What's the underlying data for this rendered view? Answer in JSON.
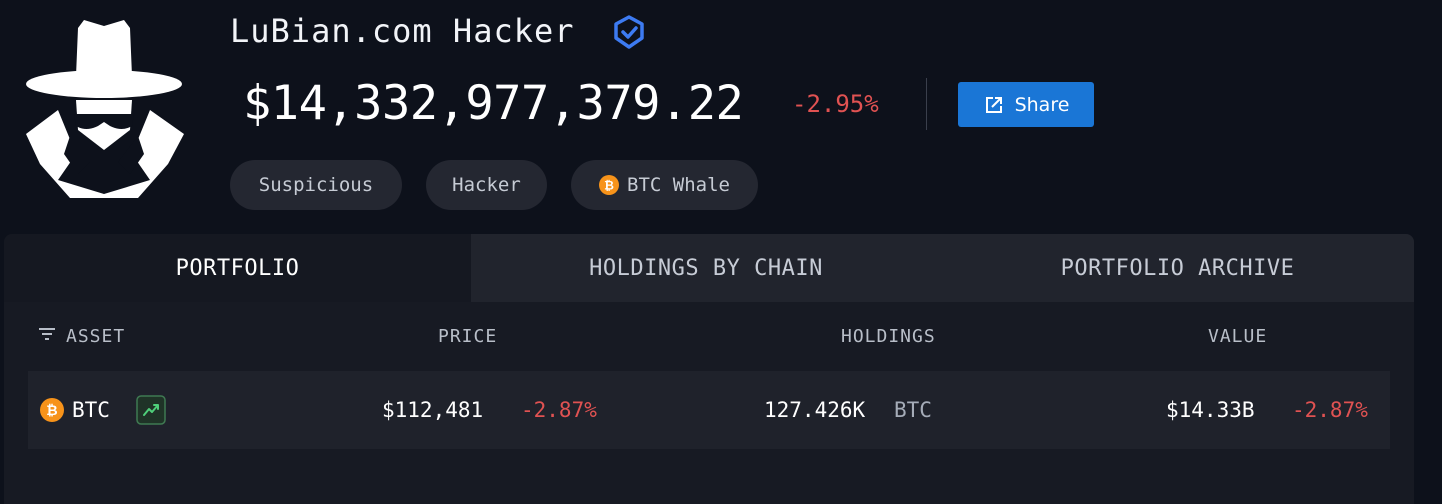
{
  "entity": {
    "name": "LuBian.com Hacker",
    "balance": "$14,332,977,379.22",
    "change": "-2.95%",
    "share_label": "Share"
  },
  "tags": [
    "Suspicious",
    "Hacker",
    "BTC Whale"
  ],
  "tabs": [
    "PORTFOLIO",
    "HOLDINGS BY CHAIN",
    "PORTFOLIO ARCHIVE"
  ],
  "table": {
    "headers": [
      "ASSET",
      "PRICE",
      "HOLDINGS",
      "VALUE"
    ],
    "rows": [
      {
        "asset": "BTC",
        "price": "$112,481",
        "price_change": "-2.87%",
        "holdings": "127.426K",
        "holdings_unit": "BTC",
        "value": "$14.33B",
        "value_change": "-2.87%"
      }
    ]
  },
  "colors": {
    "background": "#0d111b",
    "negative": "#e05252",
    "accent": "#1a76d6",
    "btc": "#f7931a",
    "verified": "#3d7bf2"
  },
  "icons": {
    "avatar": "spy-hacker-icon",
    "verified": "verified-badge-icon",
    "share": "share-icon",
    "sort": "sort-icon",
    "btc": "bitcoin-icon",
    "trend": "trending-up-icon"
  }
}
